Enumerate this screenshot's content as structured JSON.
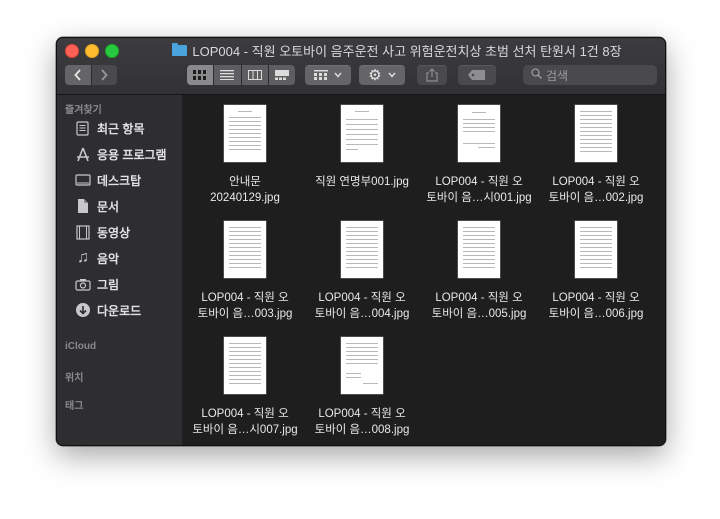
{
  "window": {
    "title": "LOP004 - 직원 오토바이 음주운전 사고 위험운전치상 초범 선처 탄원서 1건 8장"
  },
  "toolbar": {
    "search_placeholder": "검색"
  },
  "sidebar": {
    "favorites_header": "즐겨찾기",
    "items": [
      {
        "label": "최근 항목",
        "icon": "clock-doc-icon"
      },
      {
        "label": "응용 프로그램",
        "icon": "apps-icon"
      },
      {
        "label": "데스크탑",
        "icon": "desktop-icon"
      },
      {
        "label": "문서",
        "icon": "document-icon"
      },
      {
        "label": "동영상",
        "icon": "film-icon"
      },
      {
        "label": "음악",
        "icon": "music-note-icon"
      },
      {
        "label": "그림",
        "icon": "camera-icon"
      },
      {
        "label": "다운로드",
        "icon": "download-icon"
      }
    ],
    "icloud_header": "iCloud",
    "locations_header": "위치",
    "tags_header": "태그"
  },
  "files": [
    {
      "line1": "안내문",
      "line2": "20240129.jpg"
    },
    {
      "line1": "직원 연명부001.jpg",
      "line2": ""
    },
    {
      "line1": "LOP004 - 직원 오",
      "line2": "토바이 음…시001.jpg"
    },
    {
      "line1": "LOP004 - 직원 오",
      "line2": "토바이 음…002.jpg"
    },
    {
      "line1": "LOP004 - 직원 오",
      "line2": "토바이 음…003.jpg"
    },
    {
      "line1": "LOP004 - 직원 오",
      "line2": "토바이 음…004.jpg"
    },
    {
      "line1": "LOP004 - 직원 오",
      "line2": "토바이 음…005.jpg"
    },
    {
      "line1": "LOP004 - 직원 오",
      "line2": "토바이 음…006.jpg"
    },
    {
      "line1": "LOP004 - 직원 오",
      "line2": "토바이 음…시007.jpg"
    },
    {
      "line1": "LOP004 - 직원 오",
      "line2": "토바이 음…008.jpg"
    }
  ],
  "colors": {
    "window_bg": "#1e1e1f",
    "sidebar_bg": "#2e2e30",
    "folder_blue": "#4aa3dd",
    "close": "#fe5f57",
    "minimize": "#febc2e",
    "maximize": "#28c840"
  }
}
